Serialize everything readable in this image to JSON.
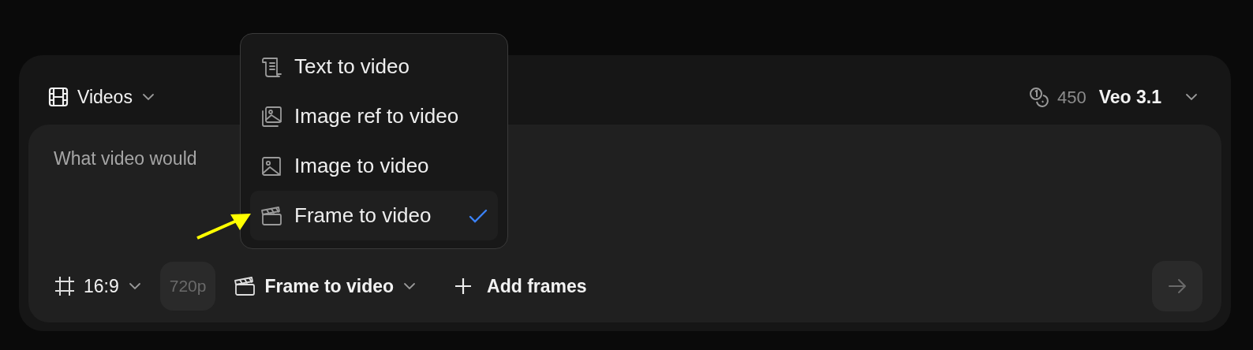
{
  "header": {
    "media_type": "Videos",
    "credits": "450",
    "model": "Veo 3.1"
  },
  "prompt": {
    "placeholder": "What video would"
  },
  "toolbar": {
    "aspect_ratio": "16:9",
    "resolution": {
      "label": "720p",
      "disabled": true
    },
    "mode": "Frame to video",
    "add": "Add frames",
    "send_disabled": true
  },
  "mode_menu": {
    "items": [
      {
        "label": "Text to video",
        "selected": false
      },
      {
        "label": "Image ref to video",
        "selected": false
      },
      {
        "label": "Image to video",
        "selected": false
      },
      {
        "label": "Frame to video",
        "selected": true
      }
    ]
  }
}
